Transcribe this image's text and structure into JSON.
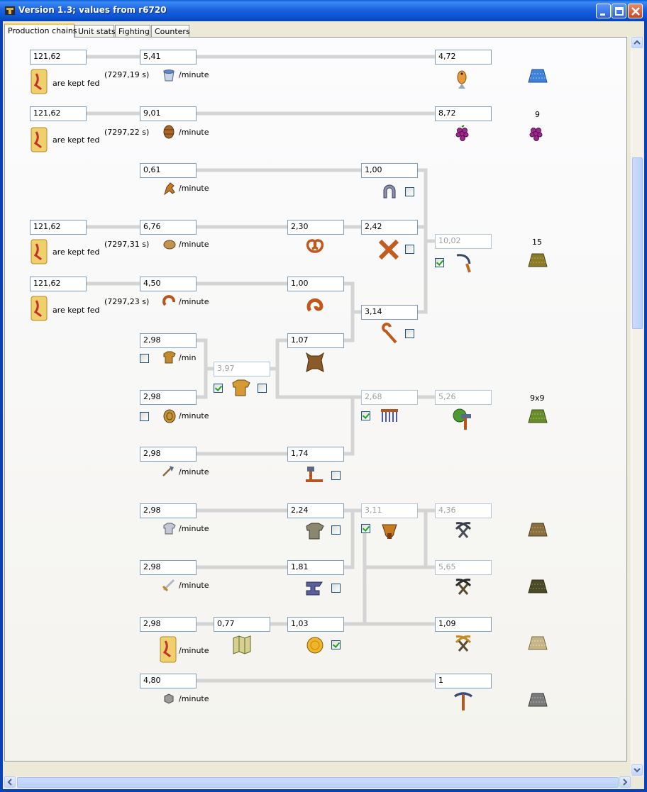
{
  "window": {
    "title": "Version 1.3; values from r6720"
  },
  "tabs": [
    "Production chains",
    "Unit stats",
    "Fighting",
    "Counters"
  ],
  "labels": {
    "kept_fed": "are kept fed",
    "per_minute": "/minute",
    "per_min_short": "/min"
  },
  "soldier_inputs": [
    "121,62",
    "121,62",
    "121,62",
    "121,62"
  ],
  "times": [
    "(7297,19 s)",
    "(7297,22 s)",
    "(7297,31 s)",
    "(7297,23 s)"
  ],
  "values": {
    "r1": [
      "5,41",
      "4,72"
    ],
    "r2": [
      "9,01",
      "8,72"
    ],
    "r3": [
      "0,61",
      "1,00"
    ],
    "r4": [
      "6,76",
      "2,30",
      "2,42",
      "10,02"
    ],
    "r5": [
      "4,50",
      "1,00",
      "3,14"
    ],
    "r6": [
      "2,98",
      "3,97",
      "1,07"
    ],
    "r7": [
      "2,98",
      "2,68",
      "5,26"
    ],
    "r8": [
      "2,98",
      "1,74"
    ],
    "r9": [
      "2,98",
      "2,24",
      "3,11",
      "4,36"
    ],
    "r10": [
      "2,98",
      "1,81",
      "5,65"
    ],
    "r11": [
      "2,98",
      "0,77",
      "1,03",
      "1,09"
    ],
    "r12": [
      "4,80",
      "1"
    ]
  },
  "land_labels": [
    "9",
    "15",
    "9x9"
  ],
  "checkboxes": {
    "horseshoe": false,
    "crossbar": false,
    "sickle": true,
    "crook": false,
    "tunic_left": false,
    "tunic_left_b": false,
    "tunic": true,
    "tunic_right": false,
    "loom": true,
    "hammer_tool": false,
    "armor": false,
    "forge": true,
    "anvil": false,
    "coin": true
  },
  "colors": {
    "title_gradient": "#1c63df",
    "connector": "#d4d4d4",
    "box_border": "#7f9db9",
    "disabled_text": "#a0a0a0"
  },
  "icons": [
    "bread-scroll-icon",
    "water-bucket-icon",
    "fish-icon",
    "barrel-icon",
    "grapes-icon",
    "horse-head-icon",
    "horseshoe-icon",
    "bread-loaf-icon",
    "pretzel-icon",
    "cross-icon",
    "sickle-icon",
    "sausage-icon",
    "crook-icon",
    "leather-tunic-icon",
    "hide-icon",
    "tunic-icon",
    "shield-icon",
    "loom-icon",
    "workshop-icon",
    "axe-icon",
    "hammer-icon",
    "chainmail-icon",
    "furnace-icon",
    "pickaxes-icon",
    "sword-icon",
    "anvil-icon",
    "map-icon",
    "coin-icon",
    "pickaxe-icon",
    "stone-icon",
    "terrain-icon"
  ]
}
